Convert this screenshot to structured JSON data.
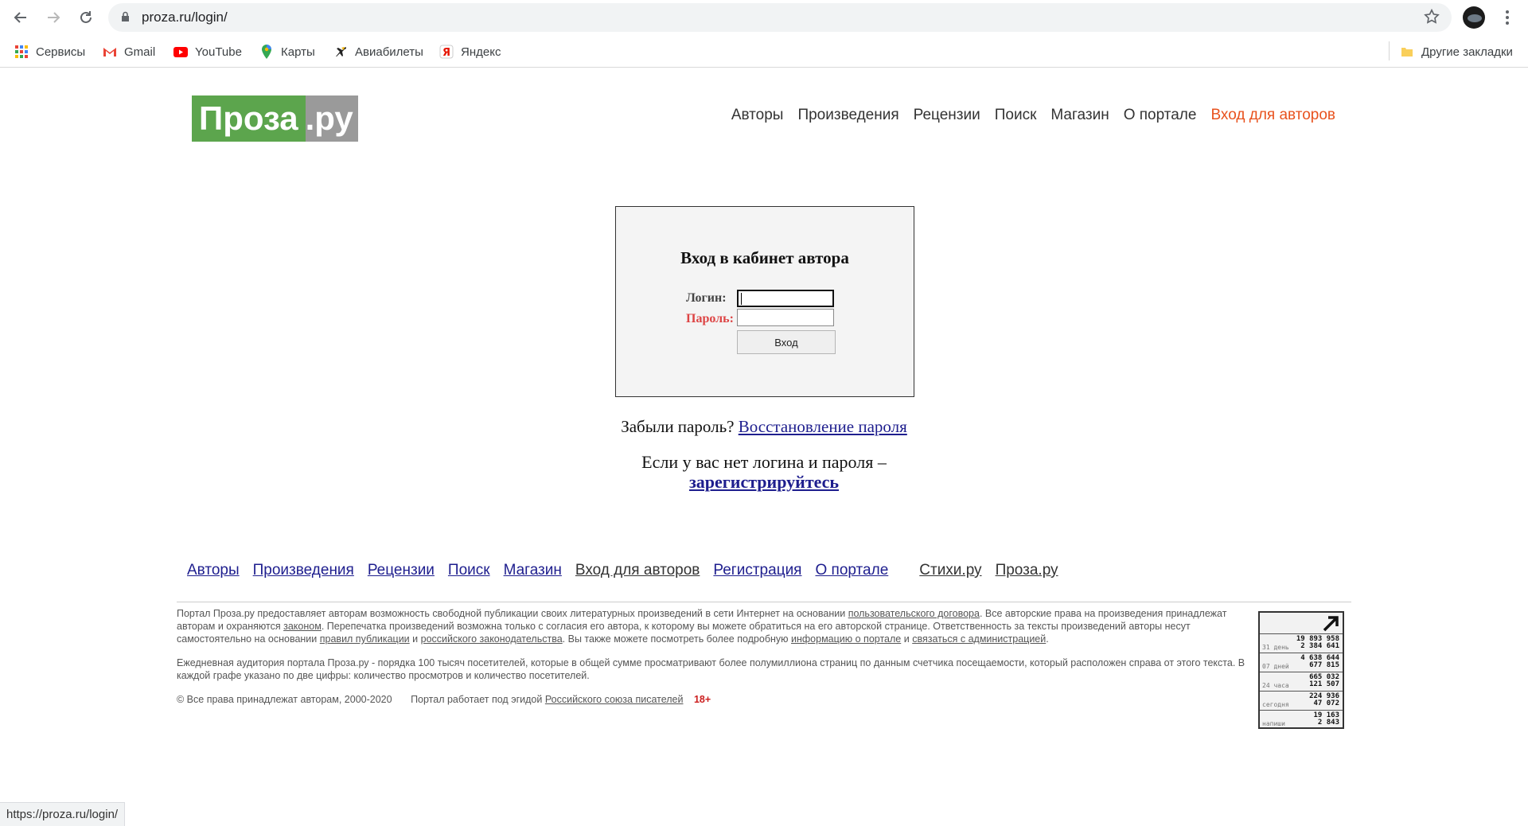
{
  "browser": {
    "url": "proza.ru/login/",
    "status_url": "https://proza.ru/login/",
    "bookmarks": [
      {
        "label": "Сервисы",
        "icon": "apps-grid-icon"
      },
      {
        "label": "Gmail",
        "icon": "gmail-icon"
      },
      {
        "label": "YouTube",
        "icon": "youtube-icon"
      },
      {
        "label": "Карты",
        "icon": "maps-pin-icon"
      },
      {
        "label": "Авиабилеты",
        "icon": "plane-icon"
      },
      {
        "label": "Яндекс",
        "icon": "yandex-icon"
      }
    ],
    "other_bookmarks": "Другие закладки"
  },
  "site": {
    "logo_main": "Проза",
    "logo_suffix": ".ру",
    "nav": [
      "Авторы",
      "Произведения",
      "Рецензии",
      "Поиск",
      "Магазин",
      "О портале",
      "Вход для авторов"
    ],
    "accent_color": "#e8521e"
  },
  "login": {
    "title": "Вход в кабинет автора",
    "login_label": "Логин:",
    "password_label": "Пароль:",
    "submit_label": "Вход"
  },
  "links": {
    "forgot_text": "Забыли пароль?",
    "forgot_link": "Восстановление пароля",
    "no_login_text": "Если у вас нет логина и пароля –",
    "register_link": "зарегистрируйтесь"
  },
  "footer": {
    "nav": [
      "Авторы",
      "Произведения",
      "Рецензии",
      "Поиск",
      "Магазин",
      "Вход для авторов",
      "Регистрация",
      "О портале"
    ],
    "sites": [
      "Стихи.ру",
      "Проза.ру"
    ],
    "p1_a": "Портал Проза.ру предоставляет авторам возможность свободной публикации своих литературных произведений в сети Интернет на основании",
    "p1_link1": "пользовательского договора",
    "p1_b": ". Все авторские права на произведения принадлежат авторам и охраняются",
    "p1_link2": "законом",
    "p1_c": ". Перепечатка произведений возможна только с согласия его автора, к которому вы можете обратиться на его авторской странице. Ответственность за тексты произведений авторы несут самостоятельно на основании",
    "p1_link3": "правил публикации",
    "p1_d": "и",
    "p1_link4": "российского законодательства",
    "p1_e": ". Вы также можете посмотреть более подробную",
    "p1_link5": "информацию о портале",
    "p1_f": "и",
    "p1_link6": "связаться с администрацией",
    "p1_g": ".",
    "p2": "Ежедневная аудитория портала Проза.ру - порядка 100 тысяч посетителей, которые в общей сумме просматривают более полумиллиона страниц по данным счетчика посещаемости, который расположен справа от этого текста. В каждой графе указано по две цифры: количество просмотров и количество посетителей.",
    "copyright": "© Все права принадлежат авторам, 2000-2020",
    "patron_text": "Портал работает под эгидой",
    "patron_link": "Российского союза писателей",
    "age": "18+"
  },
  "counter": {
    "rows": [
      {
        "label": "31 день",
        "v1": "19 893 958",
        "v2": "2 384 641"
      },
      {
        "label": "07 дней",
        "v1": "4 638 644",
        "v2": "677 815"
      },
      {
        "label": "24 часа",
        "v1": "665 032",
        "v2": "121 507"
      },
      {
        "label": "сегодня",
        "v1": "224 936",
        "v2": "47 072"
      },
      {
        "label": "напиши",
        "v1": "19 163",
        "v2": "2 843"
      }
    ]
  }
}
